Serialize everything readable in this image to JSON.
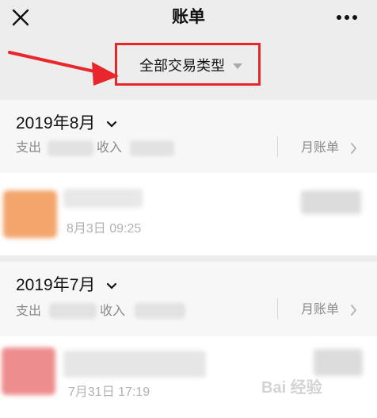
{
  "header": {
    "title": "账单",
    "close_icon": "close-icon",
    "more_icon": "more-dots-icon"
  },
  "filter": {
    "label": "全部交易类型",
    "highlight_color": "#e8272c",
    "annotation_icon": "red-arrow-icon"
  },
  "months": [
    {
      "title": "2019年8月",
      "expense_label": "支出",
      "income_label": "收入",
      "bill_link": "月账单",
      "transactions": [
        {
          "time": "8月3日 09:25",
          "avatar_color": "#f3a56c"
        }
      ]
    },
    {
      "title": "2019年7月",
      "expense_label": "支出",
      "income_label": "收入",
      "bill_link": "月账单",
      "transactions": [
        {
          "time": "7月31日 17:19",
          "avatar_color": "#ee8d8d"
        }
      ]
    }
  ],
  "watermark": "Bai 经验"
}
